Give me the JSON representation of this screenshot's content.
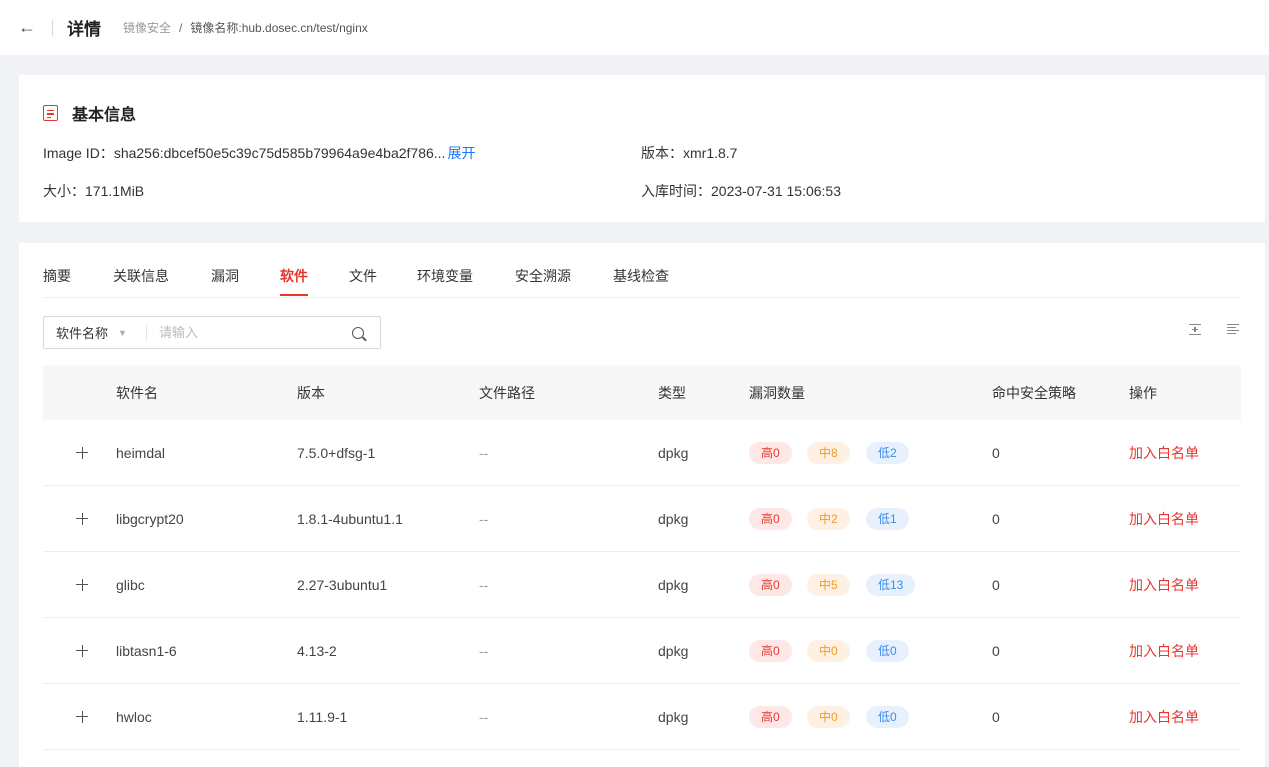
{
  "header": {
    "title": "详情",
    "breadcrumb": [
      "镜像安全",
      "镜像名称:hub.dosec.cn/test/nginx"
    ],
    "separator": "/"
  },
  "basic_info": {
    "title": "基本信息",
    "image_id_label": "Image ID：",
    "image_id": "sha256:dbcef50e5c39c75d585b79964a9e4ba2f786...",
    "expand_label": "展开",
    "size_label": "大小：",
    "size": "171.1MiB",
    "version_label": "版本：",
    "version": "xmr1.8.7",
    "ingest_time_label": "入库时间：",
    "ingest_time": "2023-07-31 15:06:53"
  },
  "tabs": [
    "摘要",
    "关联信息",
    "漏洞",
    "软件",
    "文件",
    "环境变量",
    "安全溯源",
    "基线检查"
  ],
  "active_tab": "软件",
  "search": {
    "field": "软件名称",
    "placeholder": "请输入"
  },
  "table": {
    "headers": [
      "软件名",
      "版本",
      "文件路径",
      "类型",
      "漏洞数量",
      "命中安全策略",
      "操作"
    ],
    "rows": [
      {
        "name": "heimdal",
        "version": "7.5.0+dfsg-1",
        "path": "--",
        "type": "dpkg",
        "high": "高0",
        "mid": "中8",
        "low": "低2",
        "policy": "0",
        "action": "加入白名单"
      },
      {
        "name": "libgcrypt20",
        "version": "1.8.1-4ubuntu1.1",
        "path": "--",
        "type": "dpkg",
        "high": "高0",
        "mid": "中2",
        "low": "低1",
        "policy": "0",
        "action": "加入白名单"
      },
      {
        "name": "glibc",
        "version": "2.27-3ubuntu1",
        "path": "--",
        "type": "dpkg",
        "high": "高0",
        "mid": "中5",
        "low": "低13",
        "policy": "0",
        "action": "加入白名单"
      },
      {
        "name": "libtasn1-6",
        "version": "4.13-2",
        "path": "--",
        "type": "dpkg",
        "high": "高0",
        "mid": "中0",
        "low": "低0",
        "policy": "0",
        "action": "加入白名单"
      },
      {
        "name": "hwloc",
        "version": "1.11.9-1",
        "path": "--",
        "type": "dpkg",
        "high": "高0",
        "mid": "中0",
        "low": "低0",
        "policy": "0",
        "action": "加入白名单"
      }
    ]
  },
  "colors": {
    "accent": "#e8362f",
    "link": "#1677ff",
    "badge_high": "#e8362f",
    "badge_mid": "#f59a23",
    "badge_low": "#3c8bef"
  }
}
